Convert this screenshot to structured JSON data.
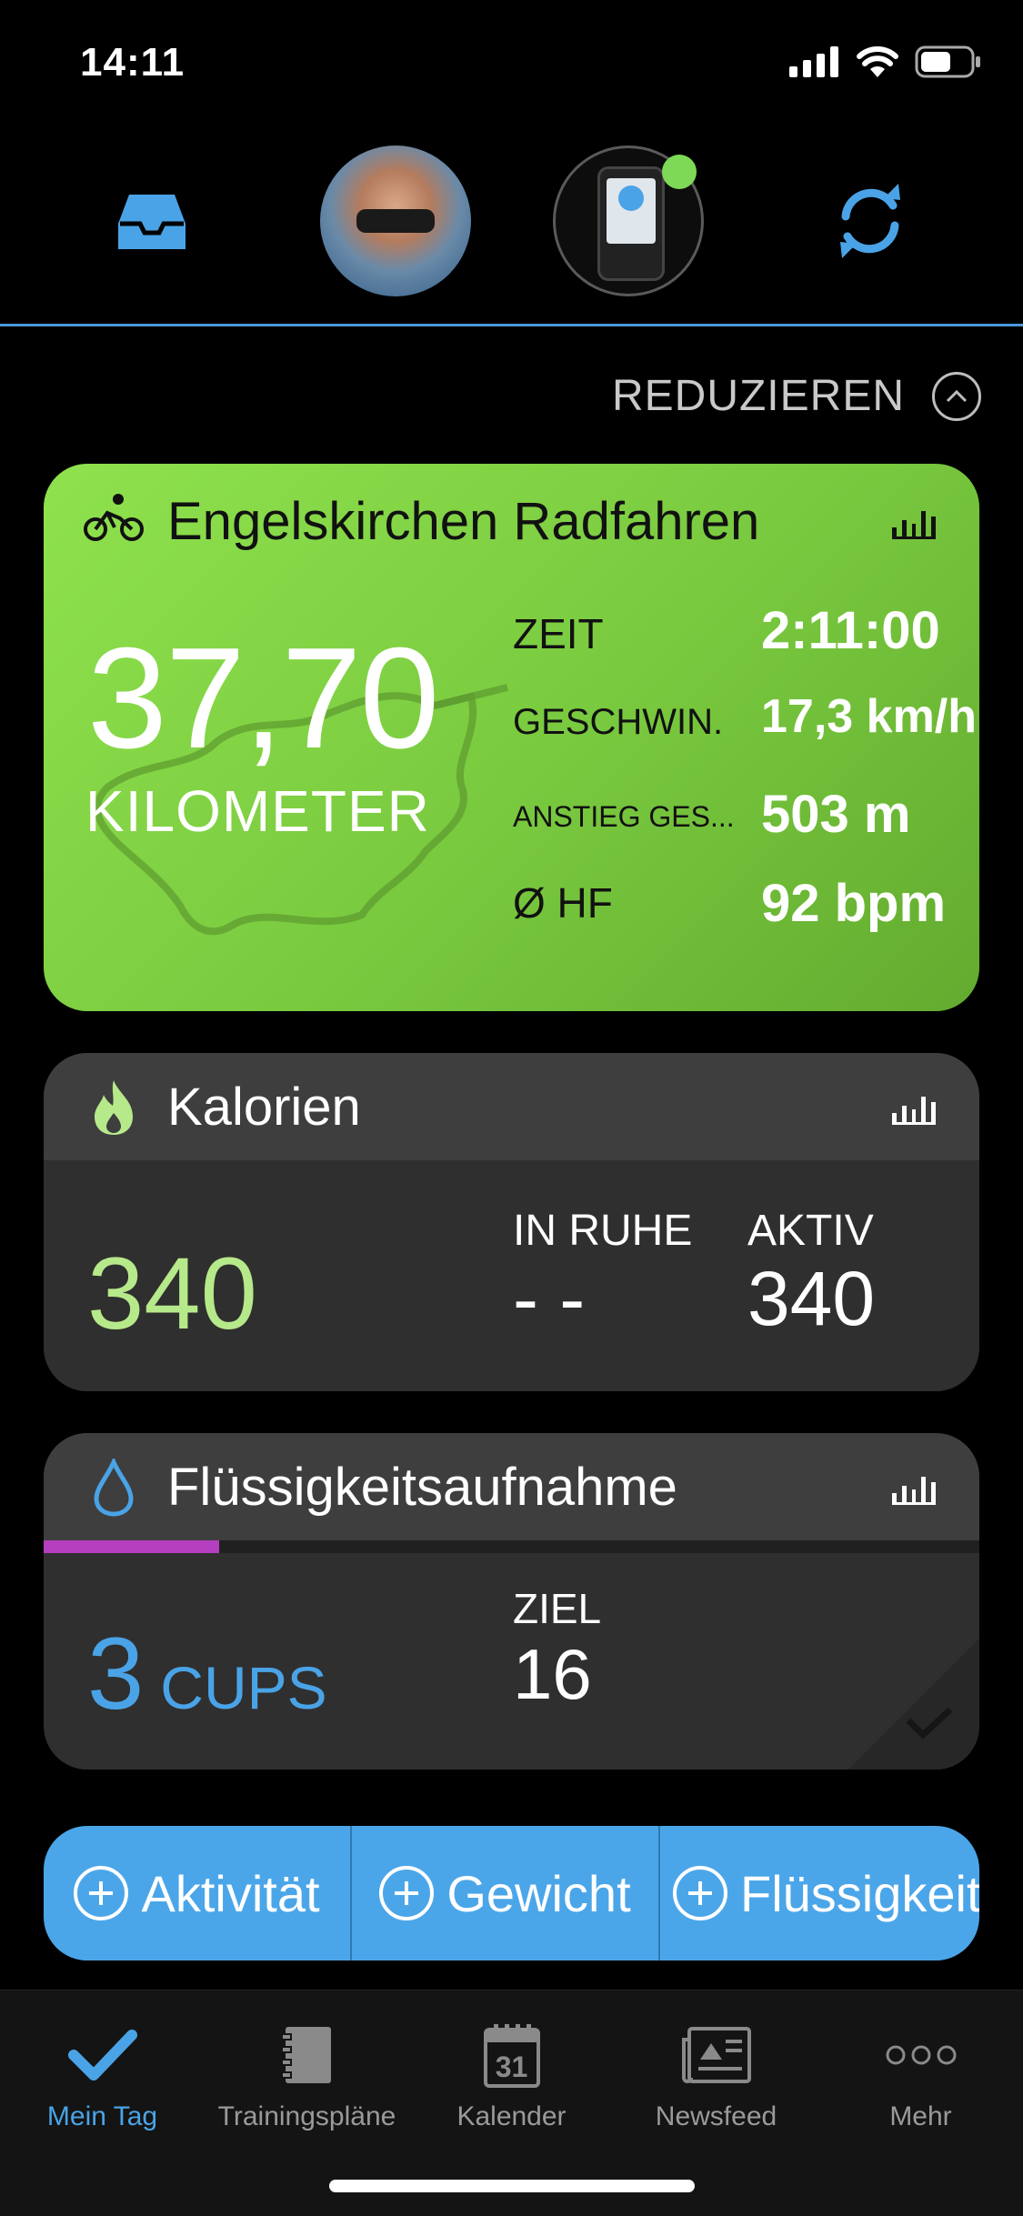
{
  "status_bar": {
    "time": "14:11"
  },
  "header": {
    "reduce_label": "REDUZIEREN"
  },
  "ride": {
    "title": "Engelskirchen Radfahren",
    "distance": "37,70",
    "distance_unit": "KILOMETER",
    "metrics": [
      {
        "label": "ZEIT",
        "value": "2:11:00"
      },
      {
        "label": "GESCHWIN.",
        "value": "17,3 km/h"
      },
      {
        "label": "ANSTIEG GES...",
        "value": "503 m"
      },
      {
        "label": "Ø HF",
        "value": "92 bpm"
      }
    ]
  },
  "calories": {
    "title": "Kalorien",
    "total": "340",
    "rest_label": "IN RUHE",
    "rest_value": "- -",
    "active_label": "AKTIV",
    "active_value": "340"
  },
  "fluids": {
    "title": "Flüssigkeitsaufnahme",
    "amount": "3",
    "unit": "CUPS",
    "goal_label": "ZIEL",
    "goal_value": "16",
    "progress_fraction": 0.1875
  },
  "actions": [
    {
      "label": "Aktivität"
    },
    {
      "label": "Gewicht"
    },
    {
      "label": "Flüssigkeit"
    }
  ],
  "tabs": [
    {
      "label": "Mein Tag",
      "icon": "checkmark-icon",
      "active": true
    },
    {
      "label": "Trainingspläne",
      "icon": "notebook-icon",
      "active": false
    },
    {
      "label": "Kalender",
      "icon": "calendar-icon",
      "calendar_day": "31",
      "active": false
    },
    {
      "label": "Newsfeed",
      "icon": "newspaper-icon",
      "active": false
    },
    {
      "label": "Mehr",
      "icon": "more-icon",
      "active": false
    }
  ],
  "colors": {
    "accent_blue": "#4ba6e9",
    "ride_green": "#7ccc41",
    "calorie_green": "#b6e98a",
    "fluid_blue": "#4aa3e6",
    "fluid_progress": "#b53fbf",
    "device_online": "#7ed957"
  }
}
